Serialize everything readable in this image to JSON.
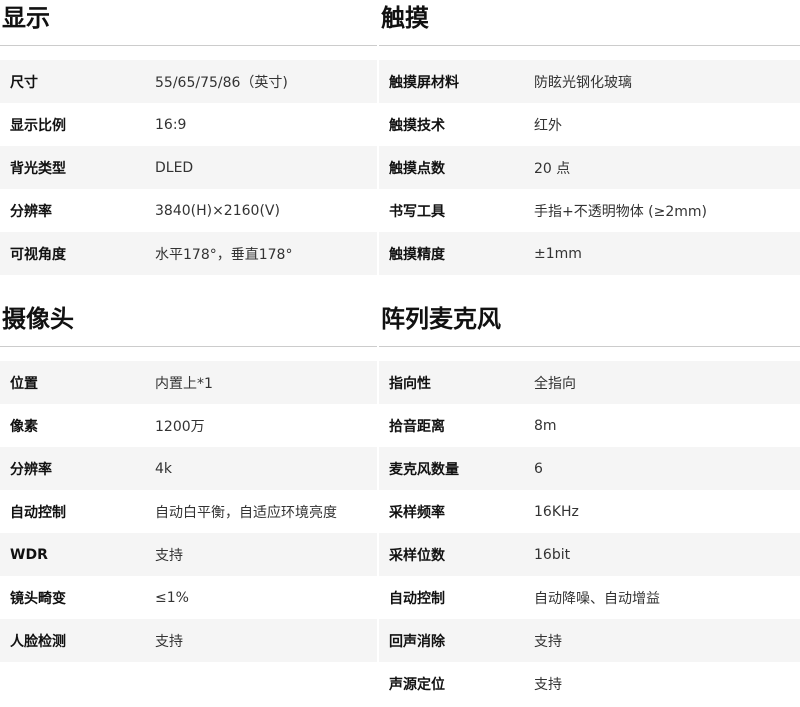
{
  "sections": [
    {
      "title": "显示",
      "rows": [
        {
          "key": "尺寸",
          "value": "55/65/75/86（英寸)"
        },
        {
          "key": "显示比例",
          "value": "16:9"
        },
        {
          "key": "背光类型",
          "value": "DLED"
        },
        {
          "key": "分辨率",
          "value": "3840(H)×2160(V)"
        },
        {
          "key": "可视角度",
          "value": "水平178°，垂直178°"
        }
      ]
    },
    {
      "title": "触摸",
      "rows": [
        {
          "key": "触摸屏材料",
          "value": "防眩光钢化玻璃"
        },
        {
          "key": "触摸技术",
          "value": "红外"
        },
        {
          "key": "触摸点数",
          "value": "20 点"
        },
        {
          "key": "书写工具",
          "value": "手指+不透明物体 (≥2mm)"
        },
        {
          "key": "触摸精度",
          "value": "±1mm"
        }
      ]
    },
    {
      "title": "摄像头",
      "rows": [
        {
          "key": "位置",
          "value": "内置上*1"
        },
        {
          "key": "像素",
          "value": "1200万"
        },
        {
          "key": "分辨率",
          "value": "4k"
        },
        {
          "key": "自动控制",
          "value": "自动白平衡，自适应环境亮度"
        },
        {
          "key": "WDR",
          "value": "支持"
        },
        {
          "key": "镜头畸变",
          "value": "≤1%"
        },
        {
          "key": "人脸检测",
          "value": "支持"
        }
      ]
    },
    {
      "title": "阵列麦克风",
      "rows": [
        {
          "key": "指向性",
          "value": "全指向"
        },
        {
          "key": "拾音距离",
          "value": "8m"
        },
        {
          "key": "麦克风数量",
          "value": "6"
        },
        {
          "key": "采样频率",
          "value": "16KHz"
        },
        {
          "key": "采样位数",
          "value": "16bit"
        },
        {
          "key": "自动控制",
          "value": "自动降噪、自动增益"
        },
        {
          "key": "回声消除",
          "value": "支持"
        },
        {
          "key": "声源定位",
          "value": "支持"
        }
      ]
    }
  ]
}
